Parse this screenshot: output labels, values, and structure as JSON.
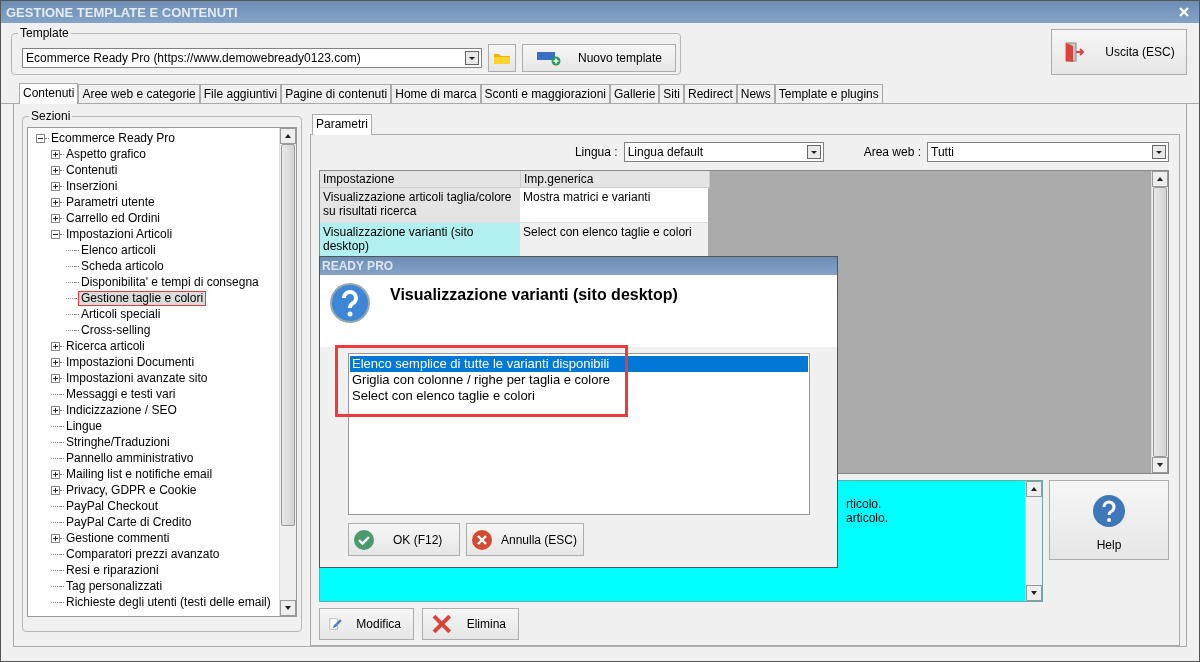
{
  "window": {
    "title": "GESTIONE TEMPLATE E CONTENUTI"
  },
  "template": {
    "label": "Template",
    "value": "Ecommerce Ready Pro (https://www.demowebready0123.com)",
    "new_button": "Nuovo template"
  },
  "exit_button": "Uscita (ESC)",
  "tabs": [
    {
      "label": "Contenuti",
      "selected": true
    },
    {
      "label": "Aree web e categorie",
      "selected": false
    },
    {
      "label": "File aggiuntivi",
      "selected": false
    },
    {
      "label": "Pagine di contenuti",
      "selected": false
    },
    {
      "label": "Home di marca",
      "selected": false
    },
    {
      "label": "Sconti e maggiorazioni",
      "selected": false
    },
    {
      "label": "Gallerie",
      "selected": false
    },
    {
      "label": "Siti",
      "selected": false
    },
    {
      "label": "Redirect",
      "selected": false
    },
    {
      "label": "News",
      "selected": false
    },
    {
      "label": "Template e plugins",
      "selected": false
    }
  ],
  "sections": {
    "label": "Sezioni",
    "tree": [
      {
        "label": "Ecommerce Ready Pro",
        "selected": false,
        "expanded": true,
        "children": [
          {
            "label": "Aspetto grafico",
            "selected": false,
            "expanded": false
          },
          {
            "label": "Contenuti",
            "selected": false,
            "expanded": false
          },
          {
            "label": "Inserzioni",
            "selected": false,
            "expanded": false
          },
          {
            "label": "Parametri utente",
            "selected": false,
            "expanded": false
          },
          {
            "label": "Carrello ed Ordini",
            "selected": false,
            "expanded": false
          },
          {
            "label": "Impostazioni Articoli",
            "selected": false,
            "expanded": true,
            "children": [
              {
                "label": "Elenco articoli",
                "selected": false
              },
              {
                "label": "Scheda articolo",
                "selected": false
              },
              {
                "label": "Disponibilita' e tempi di consegna",
                "selected": false
              },
              {
                "label": "Gestione taglie e colori",
                "selected": true,
                "annotated": true
              },
              {
                "label": "Articoli speciali",
                "selected": false
              },
              {
                "label": "Cross-selling",
                "selected": false
              }
            ]
          },
          {
            "label": "Ricerca articoli",
            "selected": false,
            "expanded": false
          },
          {
            "label": "Impostazioni Documenti",
            "selected": false,
            "expanded": false
          },
          {
            "label": "Impostazioni avanzate sito",
            "selected": false,
            "expanded": false
          },
          {
            "label": "Messaggi e testi vari",
            "selected": false
          },
          {
            "label": "Indicizzazione / SEO",
            "selected": false,
            "expanded": false
          },
          {
            "label": "Lingue",
            "selected": false
          },
          {
            "label": "Stringhe/Traduzioni",
            "selected": false
          },
          {
            "label": "Pannello amministrativo",
            "selected": false
          },
          {
            "label": "Mailing list e notifiche email",
            "selected": false,
            "expanded": false
          },
          {
            "label": "Privacy, GDPR e Cookie",
            "selected": false,
            "expanded": false
          },
          {
            "label": "PayPal Checkout",
            "selected": false
          },
          {
            "label": "PayPal Carte di Credito",
            "selected": false
          },
          {
            "label": "Gestione commenti",
            "selected": false,
            "expanded": false
          },
          {
            "label": "Comparatori prezzi avanzato",
            "selected": false
          },
          {
            "label": "Resi e riparazioni",
            "selected": false
          },
          {
            "label": "Tag personalizzati",
            "selected": false
          },
          {
            "label": "Richieste degli utenti (testi delle email)",
            "selected": false
          }
        ]
      }
    ]
  },
  "subtabs": [
    {
      "label": "Parametri",
      "selected": true
    }
  ],
  "filters": [
    {
      "label": "Lingua :",
      "value": "Lingua default"
    },
    {
      "label": "Area web :",
      "value": "Tutti"
    }
  ],
  "table": {
    "columns": [
      "Impostazione",
      "Imp.generica"
    ],
    "rows": [
      {
        "cells": [
          "Visualizzazione articoli taglia/colore su risultati ricerca",
          "Mostra matrici e varianti"
        ],
        "selected": false
      },
      {
        "cells": [
          "Visualizzazione varianti (sito desktop)",
          "Select con elenco taglie e colori"
        ],
        "selected": true
      }
    ]
  },
  "description": {
    "lines": [
      "rticolo.",
      "articolo."
    ]
  },
  "help_button": "Help",
  "actions": [
    {
      "label": "Modifica",
      "kind": "edit"
    },
    {
      "label": "Elimina",
      "kind": "delete"
    }
  ],
  "dialog": {
    "title": "READY PRO",
    "heading": "Visualizzazione varianti (sito desktop)",
    "annotated": true,
    "options": [
      {
        "label": "Elenco semplice di tutte le varianti disponibili",
        "selected": true
      },
      {
        "label": "Griglia con colonne / righe per taglia e colore",
        "selected": false
      },
      {
        "label": "Select con elenco taglie e colori",
        "selected": false
      }
    ],
    "buttons": [
      {
        "label": "OK (F12)",
        "kind": "ok"
      },
      {
        "label": "Annulla (ESC)",
        "kind": "cancel"
      }
    ]
  }
}
